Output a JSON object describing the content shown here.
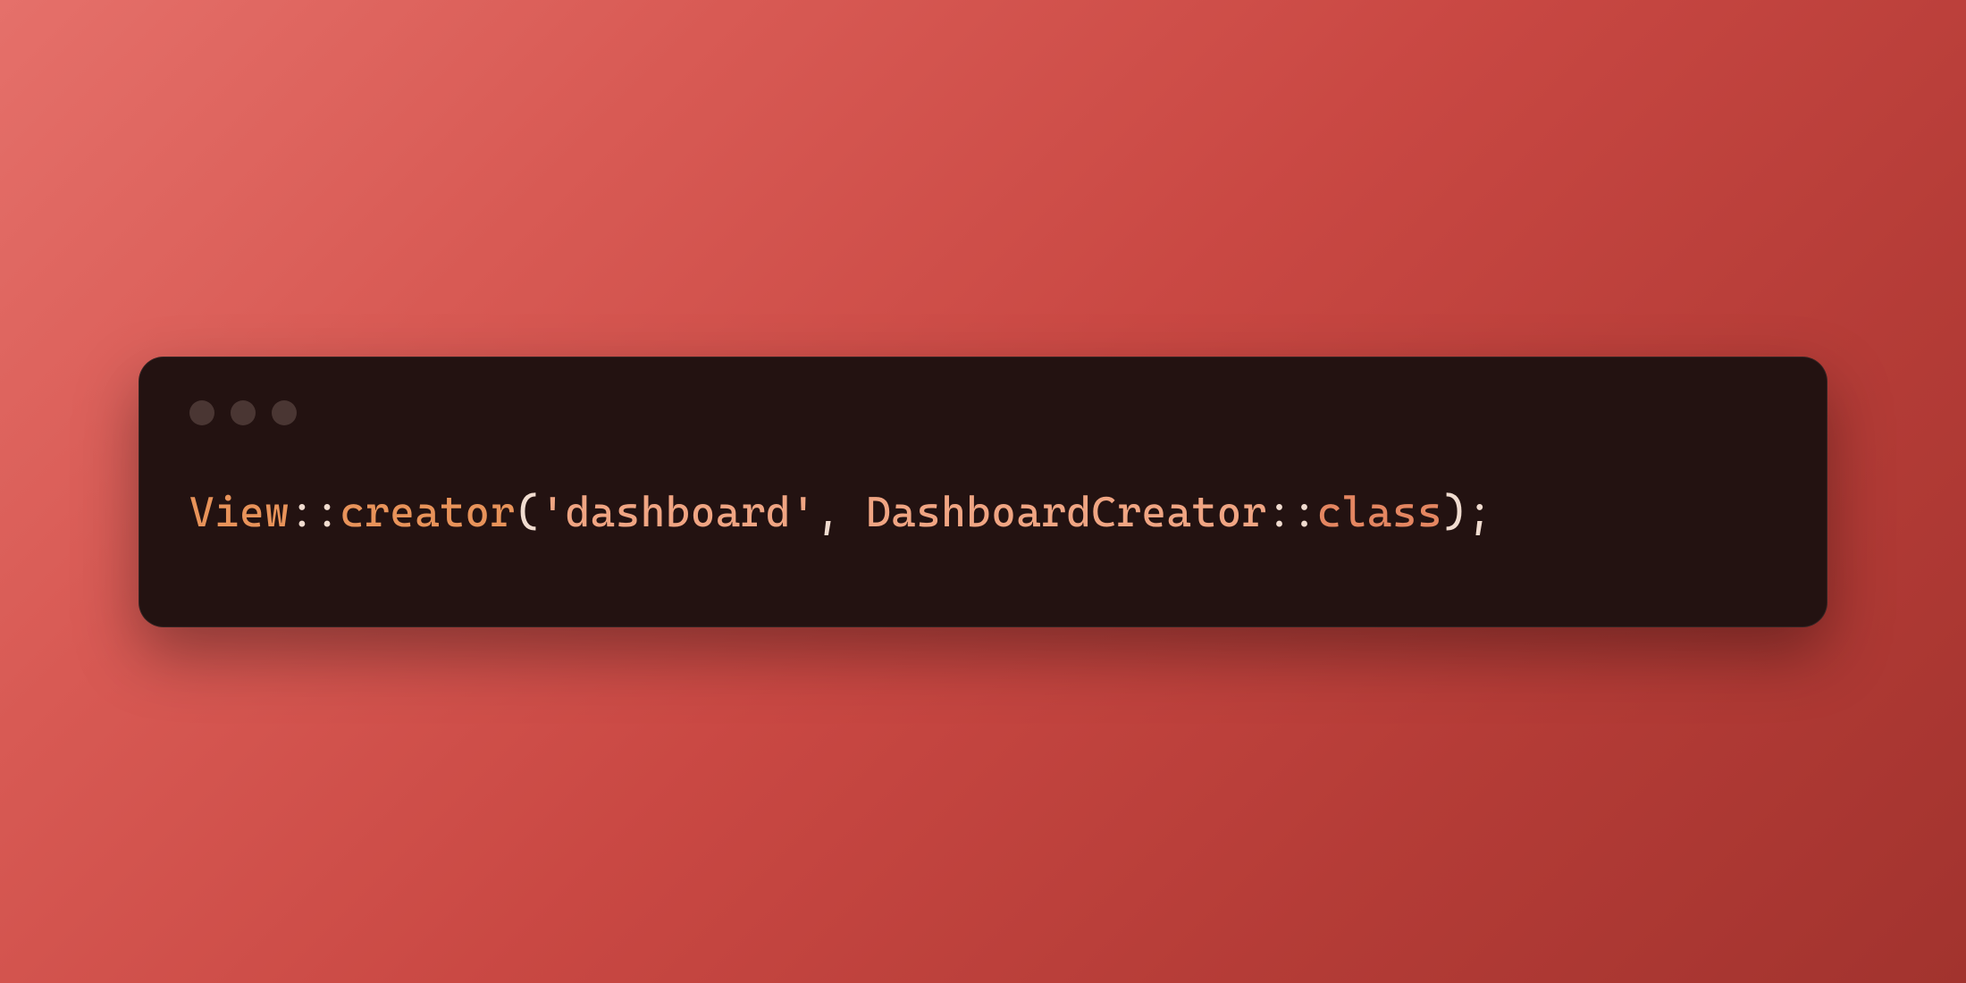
{
  "code": {
    "tokens": {
      "t1": "View",
      "t2": "::",
      "t3": "creator",
      "t4": "(",
      "t5": "'dashboard'",
      "t6": ", ",
      "t7": "DashboardCreator",
      "t8": "::",
      "t9": "class",
      "t10": ")",
      "t11": ";"
    }
  }
}
